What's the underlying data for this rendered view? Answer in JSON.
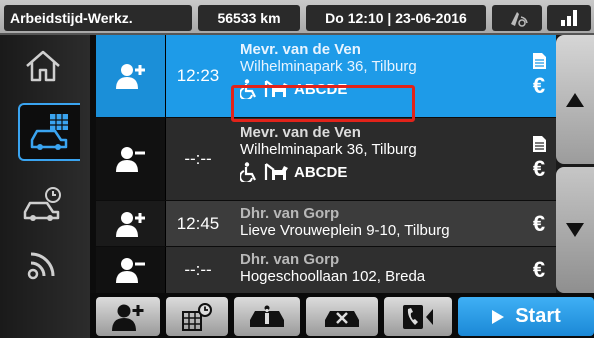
{
  "status_bar": {
    "mode": "Arbeidstijd-Werkz.",
    "odometer": "56533 km",
    "datetime": "Do 12:10 | 23-06-2016"
  },
  "trips": [
    {
      "action": "pickup",
      "time": "12:23",
      "name": "Mevr. van de Ven",
      "address": "Wilhelminapark 36, Tilburg",
      "tag": "ABCDE",
      "payment": "€",
      "selected": true
    },
    {
      "action": "dropoff",
      "time": "--:--",
      "name": "Mevr. van de Ven",
      "address": "Wilhelminapark 36, Tilburg",
      "tag": "ABCDE",
      "payment": "€",
      "selected": false
    },
    {
      "action": "pickup",
      "time": "12:45",
      "name": "Dhr. van Gorp",
      "address": "Lieve Vrouweplein 9-10, Tilburg",
      "payment": "€",
      "selected": false
    },
    {
      "action": "dropoff",
      "time": "--:--",
      "name": "Dhr. van Gorp",
      "address": "Hogeschoollaan 102, Breda",
      "payment": "€",
      "selected": false
    }
  ],
  "toolbar": {
    "start_label": "Start"
  },
  "colors": {
    "accent_blue": "#1e9be8",
    "highlight_red": "#e2231a"
  }
}
